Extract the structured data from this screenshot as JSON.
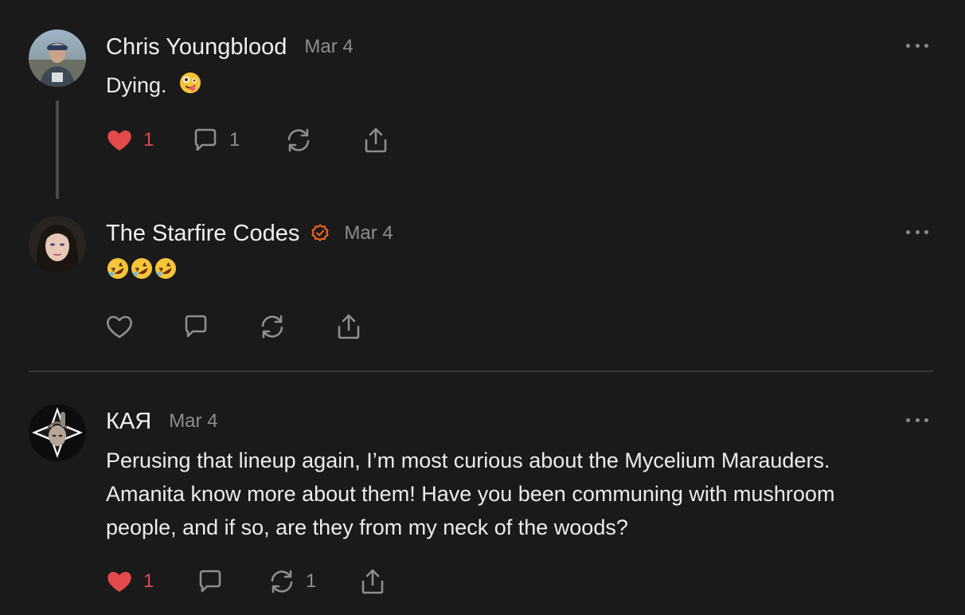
{
  "colors": {
    "background": "#1a1a1b",
    "like_active": "#e44a4a",
    "verified_badge": "#ff6719",
    "icon": "#8e8e91"
  },
  "posts": [
    {
      "author": "Chris Youngblood",
      "date": "Mar 4",
      "text": "Dying.",
      "emojis": [
        "zany-face"
      ],
      "liked": true,
      "like_count": "1",
      "comment_count": "1",
      "restack_count": "",
      "verified": false
    },
    {
      "author": "The Starfire Codes",
      "date": "Mar 4",
      "text": "",
      "emojis": [
        "rolling-on-floor-laughing",
        "rolling-on-floor-laughing",
        "rolling-on-floor-laughing"
      ],
      "liked": false,
      "like_count": "",
      "comment_count": "",
      "restack_count": "",
      "verified": true
    },
    {
      "author": "КАЯ",
      "date": "Mar 4",
      "text": "Perusing that lineup again, I’m most curious about the Mycelium Marauders. Amanita know more about them! Have you been communing with mushroom people, and if so, are they from my neck of the woods?",
      "emojis": [],
      "liked": true,
      "like_count": "1",
      "comment_count": "",
      "restack_count": "1",
      "verified": false
    }
  ]
}
